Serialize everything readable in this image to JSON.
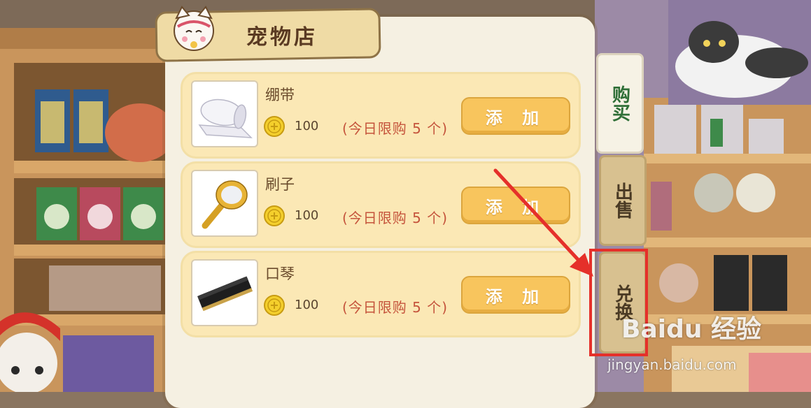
{
  "shop": {
    "title": "宠物店",
    "items": [
      {
        "name": "绷带",
        "price": "100",
        "limit": "(今日限购 5 个)",
        "button": "添 加"
      },
      {
        "name": "刷子",
        "price": "100",
        "limit": "(今日限购 5 个)",
        "button": "添 加"
      },
      {
        "name": "口琴",
        "price": "100",
        "limit": "(今日限购 5 个)",
        "button": "添 加"
      }
    ]
  },
  "tabs": {
    "buy": "购买",
    "sell": "出售",
    "exchange": "兑换"
  },
  "watermark": {
    "brand": "Baidu 经验",
    "url": "jingyan.baidu.com"
  },
  "colors": {
    "accent_button": "#f8c55d",
    "highlight_box": "#e5302a",
    "arrow": "#e5302a",
    "buy_tab_text": "#2f6f37"
  }
}
